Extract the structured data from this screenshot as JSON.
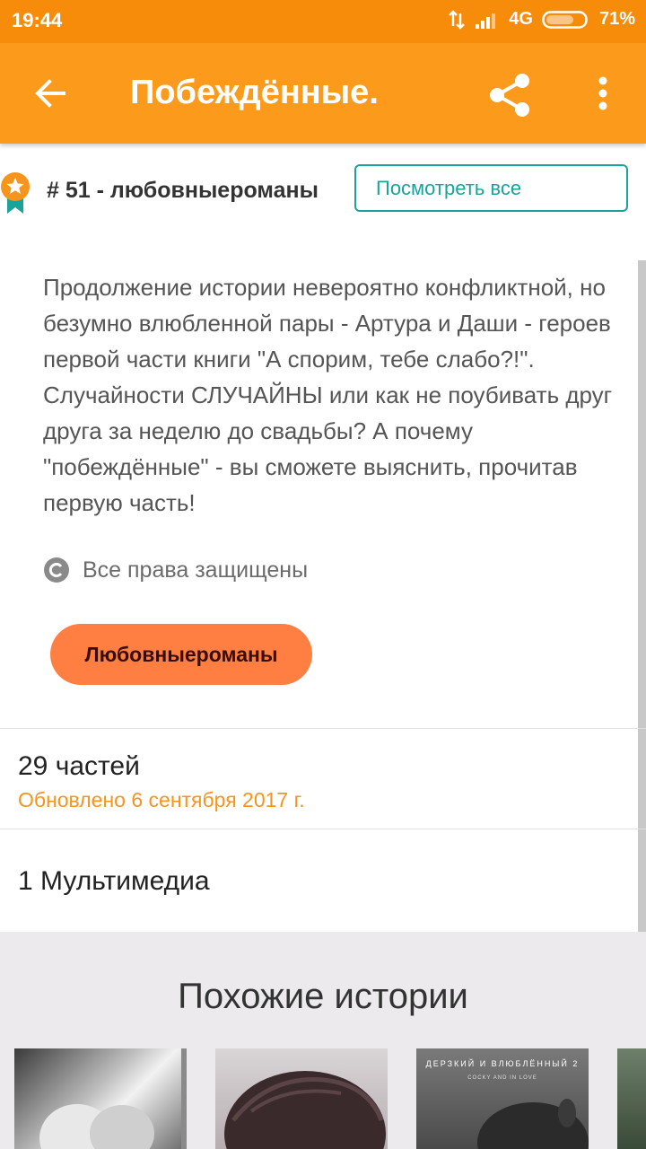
{
  "status_bar": {
    "time": "19:44",
    "network": "4G",
    "battery": "71%"
  },
  "app_bar": {
    "title": "Побеждённые.",
    "back_icon": "arrow-back-icon",
    "share_icon": "share-icon",
    "more_icon": "more-vert-icon"
  },
  "ranking": {
    "text": "# 51 - любовныероманы",
    "view_all_label": "Посмотреть все"
  },
  "description": "Продолжение истории невероятно конфликтной, но безумно влюбленной пары - Артура и Даши - героев первой части книги \"А спорим, тебе слабо?!\". Случайности СЛУЧАЙНЫ или как не поубивать друг друга за неделю до свадьбы? А почему \"побеждённые\" - вы сможете выяснить, прочитав первую часть!",
  "copyright": {
    "label": "Все права защищены",
    "icon": "copyright-icon"
  },
  "tag": {
    "label": "Любовныероманы"
  },
  "parts": {
    "count_label": "29 частей",
    "updated_label": "Обновлено 6 сентября 2017 г."
  },
  "media": {
    "label": "1 Мультимедиа"
  },
  "similar": {
    "title": "Похожие истории",
    "covers": [
      {
        "overlay": ""
      },
      {
        "overlay": ""
      },
      {
        "overlay": "ДЕРЗКИЙ И ВЛЮБЛЁННЫЙ 2",
        "subtitle": "COCKY AND IN LOVE"
      },
      {
        "overlay": ""
      }
    ]
  },
  "colors": {
    "status_bar": "#f78c0a",
    "app_bar": "#fc9a1b",
    "accent_teal": "#1aa39a",
    "tag_button": "#ff7f43",
    "updated_text": "#f7941d",
    "section_bg": "#eceaed"
  }
}
